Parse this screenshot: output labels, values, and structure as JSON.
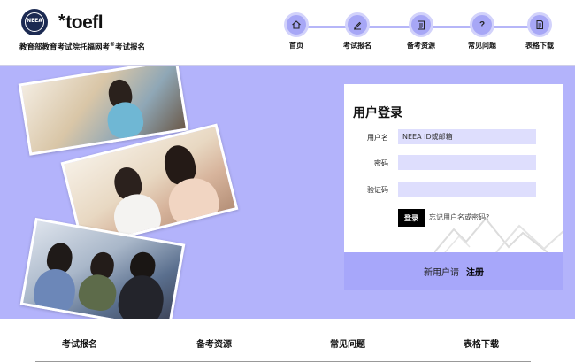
{
  "header": {
    "logo_text": "NEEA",
    "brand": "toefl",
    "brand_mark": "*",
    "site_name_prefix": "教育部教育考试院托福网考",
    "site_name_sup": "®",
    "site_name_suffix": "考试报名",
    "nav": [
      {
        "label": "首页",
        "icon": "home-icon"
      },
      {
        "label": "考试报名",
        "icon": "edit-icon"
      },
      {
        "label": "备考资源",
        "icon": "clipboard-icon"
      },
      {
        "label": "常见问题",
        "icon": "question-icon"
      },
      {
        "label": "表格下载",
        "icon": "document-icon"
      }
    ]
  },
  "login": {
    "title": "用户登录",
    "username_label": "用户名",
    "username_placeholder": "NEEA ID或邮箱",
    "password_label": "密码",
    "captcha_label": "验证码",
    "login_button": "登录",
    "forgot_link": "忘记用户名或密码?"
  },
  "register": {
    "prompt": "新用户请",
    "link": "注册"
  },
  "footer": {
    "items": [
      "考试报名",
      "备考资源",
      "常见问题",
      "表格下载"
    ]
  },
  "colors": {
    "hero_bg": "#b3b3fb",
    "nav_circle": "#a7a7f6",
    "input_bg": "#dedefd",
    "register_bg": "#a7a7fa"
  }
}
